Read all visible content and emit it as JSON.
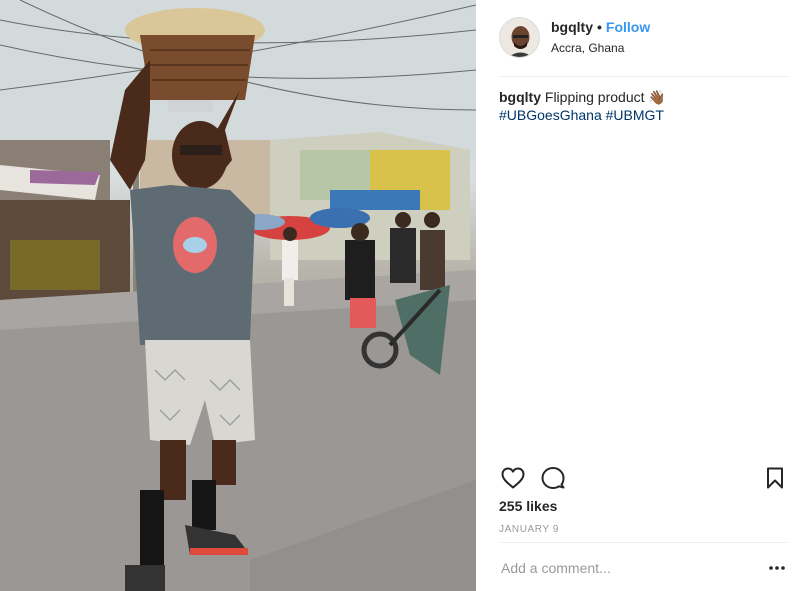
{
  "post": {
    "username": "bgqlty",
    "separator": "•",
    "follow_label": "Follow",
    "location": "Accra, Ghana",
    "caption_user": "bgqlty",
    "caption_text": "Flipping product 👋🏾",
    "hashtags": [
      "#UBGoesGhana",
      "#UBMGT"
    ],
    "likes": "255 likes",
    "date": "JANUARY 9"
  },
  "comment": {
    "placeholder": "Add a comment..."
  },
  "icons": {
    "like": "heart-icon",
    "comment": "comment-bubble-icon",
    "save": "bookmark-icon",
    "more": "ellipsis-icon"
  },
  "colors": {
    "link": "#3897f0",
    "hashtag": "#003569",
    "text": "#262626",
    "muted": "#999999"
  }
}
